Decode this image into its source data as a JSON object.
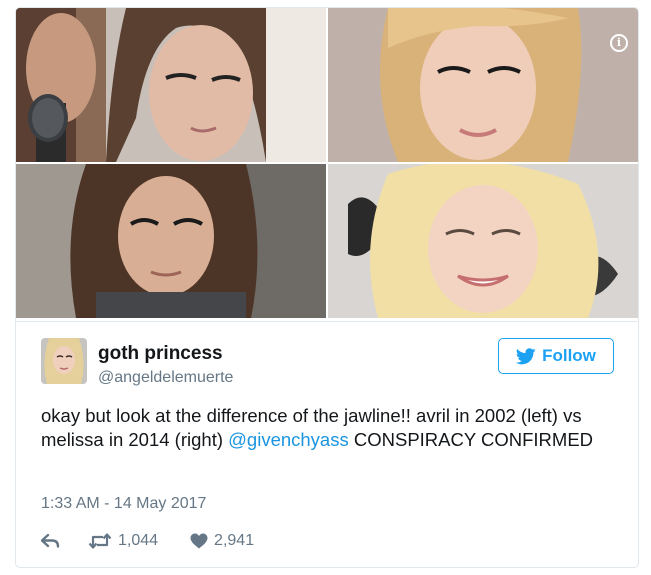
{
  "tweet": {
    "display_name": "goth princess",
    "handle": "@angeldelemuerte",
    "text_before_mention": "okay but look at the difference of the jawline!! avril in 2002 (left) vs melissa in 2014 (right) ",
    "mention": "@givenchyass",
    "text_after_mention": " CONSPIRACY CONFIRMED",
    "timestamp": "1:33 AM - 14 May 2017",
    "retweet_count": "1,044",
    "like_count": "2,941"
  },
  "follow_button": {
    "label": "Follow"
  },
  "icons": {
    "media_info": "info-icon",
    "follow": "twitter-bird-icon",
    "reply": "reply-arrow-icon",
    "retweet": "retweet-icon",
    "like": "heart-icon"
  },
  "colors": {
    "twitter_blue": "#1da1f2",
    "mention": "#1b95e0",
    "secondary_text": "#657786",
    "border": "#e1e8ed"
  }
}
